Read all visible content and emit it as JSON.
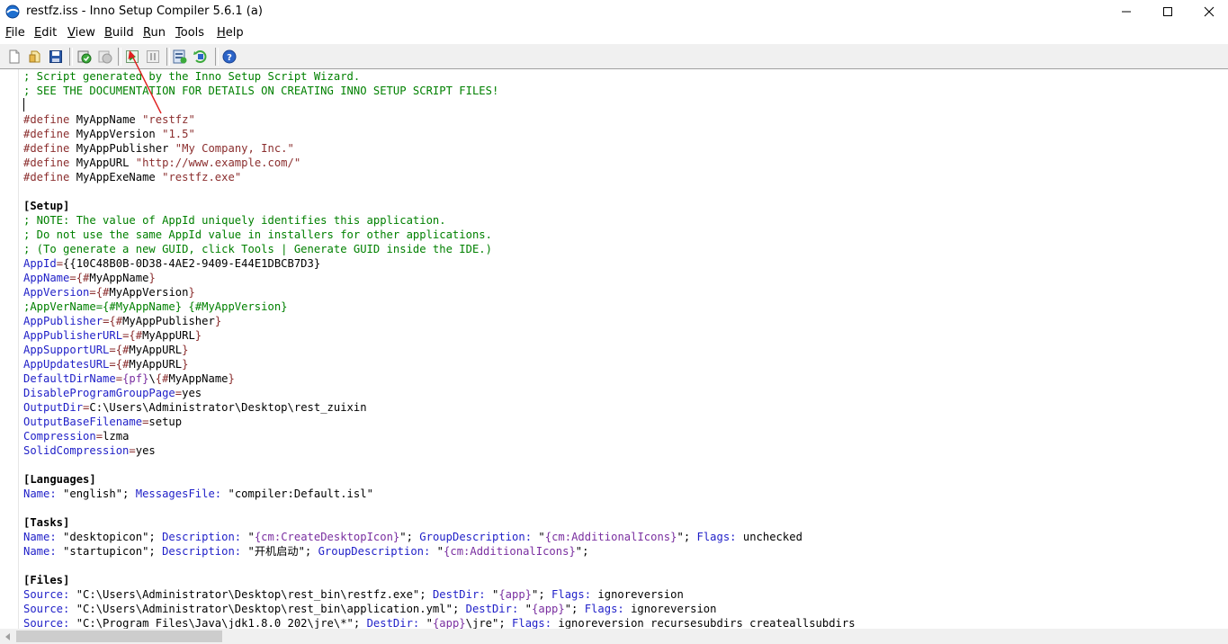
{
  "window": {
    "title": "restfz.iss - Inno Setup Compiler 5.6.1 (a)",
    "controls": {
      "minimize": "—",
      "maximize": "☐",
      "close": "✕"
    }
  },
  "menu": {
    "items": [
      {
        "mnemonic": "F",
        "rest": "ile"
      },
      {
        "mnemonic": "E",
        "rest": "dit"
      },
      {
        "mnemonic": "V",
        "rest": "iew"
      },
      {
        "mnemonic": "B",
        "rest": "uild"
      },
      {
        "mnemonic": "R",
        "rest": "un"
      },
      {
        "mnemonic": "T",
        "rest": "ools"
      },
      {
        "mnemonic": "H",
        "rest": "elp"
      }
    ]
  },
  "toolbar": {
    "buttons": [
      "new-file-icon",
      "open-folder-icon",
      "save-icon",
      "compile-icon",
      "stop-compile-icon",
      "run-icon",
      "pause-icon",
      "target-setup-icon",
      "uninstall-icon",
      "help-icon"
    ],
    "colors": {
      "run": "#2aa02a",
      "help": "#2c64c8"
    }
  },
  "editor": {
    "lines": [
      [
        [
          "cm",
          "; Script generated by the Inno Setup Script Wizard."
        ]
      ],
      [
        [
          "cm",
          "; SEE THE DOCUMENTATION FOR DETAILS ON CREATING INNO SETUP SCRIPT FILES!"
        ]
      ],
      [
        [
          "caret",
          ""
        ]
      ],
      [
        [
          "pp",
          "#define"
        ],
        [
          "pl",
          " MyAppName "
        ],
        [
          "st",
          "\"restfz\""
        ]
      ],
      [
        [
          "pp",
          "#define"
        ],
        [
          "pl",
          " MyAppVersion "
        ],
        [
          "st",
          "\"1.5\""
        ]
      ],
      [
        [
          "pp",
          "#define"
        ],
        [
          "pl",
          " MyAppPublisher "
        ],
        [
          "st",
          "\"My Company, Inc.\""
        ]
      ],
      [
        [
          "pp",
          "#define"
        ],
        [
          "pl",
          " MyAppURL "
        ],
        [
          "st",
          "\"http://www.example.com/\""
        ]
      ],
      [
        [
          "pp",
          "#define"
        ],
        [
          "pl",
          " MyAppExeName "
        ],
        [
          "st",
          "\"restfz.exe\""
        ]
      ],
      [],
      [
        [
          "sec",
          "[Setup]"
        ]
      ],
      [
        [
          "cm",
          "; NOTE: The value of AppId uniquely identifies this application."
        ]
      ],
      [
        [
          "cm",
          "; Do not use the same AppId value in installers for other applications."
        ]
      ],
      [
        [
          "cm",
          "; (To generate a new GUID, click Tools | Generate GUID inside the IDE.)"
        ]
      ],
      [
        [
          "kw",
          "AppId"
        ],
        [
          "op",
          "="
        ],
        [
          "pl",
          "{{10C48B0B-0D38-4AE2-9409-E44E1DBCB7D3}"
        ]
      ],
      [
        [
          "kw",
          "AppName"
        ],
        [
          "op",
          "="
        ],
        [
          "brace",
          "{#"
        ],
        [
          "pl",
          "MyAppName"
        ],
        [
          "brace",
          "}"
        ]
      ],
      [
        [
          "kw",
          "AppVersion"
        ],
        [
          "op",
          "="
        ],
        [
          "brace",
          "{#"
        ],
        [
          "pl",
          "MyAppVersion"
        ],
        [
          "brace",
          "}"
        ]
      ],
      [
        [
          "cm",
          ";AppVerName={#MyAppName} {#MyAppVersion}"
        ]
      ],
      [
        [
          "kw",
          "AppPublisher"
        ],
        [
          "op",
          "="
        ],
        [
          "brace",
          "{#"
        ],
        [
          "pl",
          "MyAppPublisher"
        ],
        [
          "brace",
          "}"
        ]
      ],
      [
        [
          "kw",
          "AppPublisherURL"
        ],
        [
          "op",
          "="
        ],
        [
          "brace",
          "{#"
        ],
        [
          "pl",
          "MyAppURL"
        ],
        [
          "brace",
          "}"
        ]
      ],
      [
        [
          "kw",
          "AppSupportURL"
        ],
        [
          "op",
          "="
        ],
        [
          "brace",
          "{#"
        ],
        [
          "pl",
          "MyAppURL"
        ],
        [
          "brace",
          "}"
        ]
      ],
      [
        [
          "kw",
          "AppUpdatesURL"
        ],
        [
          "op",
          "="
        ],
        [
          "brace",
          "{#"
        ],
        [
          "pl",
          "MyAppURL"
        ],
        [
          "brace",
          "}"
        ]
      ],
      [
        [
          "kw",
          "DefaultDirName"
        ],
        [
          "op",
          "="
        ],
        [
          "cons",
          "{pf}"
        ],
        [
          "pl",
          "\\"
        ],
        [
          "brace",
          "{#"
        ],
        [
          "pl",
          "MyAppName"
        ],
        [
          "brace",
          "}"
        ]
      ],
      [
        [
          "kw",
          "DisableProgramGroupPage"
        ],
        [
          "op",
          "="
        ],
        [
          "pl",
          "yes"
        ]
      ],
      [
        [
          "kw",
          "OutputDir"
        ],
        [
          "op",
          "="
        ],
        [
          "pl",
          "C:\\Users\\Administrator\\Desktop\\rest_zuixin"
        ]
      ],
      [
        [
          "kw",
          "OutputBaseFilename"
        ],
        [
          "op",
          "="
        ],
        [
          "pl",
          "setup"
        ]
      ],
      [
        [
          "kw",
          "Compression"
        ],
        [
          "op",
          "="
        ],
        [
          "pl",
          "lzma"
        ]
      ],
      [
        [
          "kw",
          "SolidCompression"
        ],
        [
          "op",
          "="
        ],
        [
          "pl",
          "yes"
        ]
      ],
      [],
      [
        [
          "sec",
          "[Languages]"
        ]
      ],
      [
        [
          "kw",
          "Name:"
        ],
        [
          "pl",
          " \"english\"; "
        ],
        [
          "kw",
          "MessagesFile:"
        ],
        [
          "pl",
          " \"compiler:Default.isl\""
        ]
      ],
      [],
      [
        [
          "sec",
          "[Tasks]"
        ]
      ],
      [
        [
          "kw",
          "Name:"
        ],
        [
          "pl",
          " \"desktopicon\"; "
        ],
        [
          "kw",
          "Description:"
        ],
        [
          "pl",
          " \""
        ],
        [
          "cons",
          "{cm:CreateDesktopIcon}"
        ],
        [
          "pl",
          "\"; "
        ],
        [
          "kw",
          "GroupDescription:"
        ],
        [
          "pl",
          " \""
        ],
        [
          "cons",
          "{cm:AdditionalIcons}"
        ],
        [
          "pl",
          "\"; "
        ],
        [
          "kw",
          "Flags:"
        ],
        [
          "pl",
          " unchecked"
        ]
      ],
      [
        [
          "kw",
          "Name:"
        ],
        [
          "pl",
          " \"startupicon\"; "
        ],
        [
          "kw",
          "Description:"
        ],
        [
          "pl",
          " \"开机启动\"; "
        ],
        [
          "kw",
          "GroupDescription:"
        ],
        [
          "pl",
          " \""
        ],
        [
          "cons",
          "{cm:AdditionalIcons}"
        ],
        [
          "pl",
          "\";"
        ]
      ],
      [],
      [
        [
          "sec",
          "[Files]"
        ]
      ],
      [
        [
          "kw",
          "Source:"
        ],
        [
          "pl",
          " \"C:\\Users\\Administrator\\Desktop\\rest_bin\\restfz.exe\"; "
        ],
        [
          "kw",
          "DestDir:"
        ],
        [
          "pl",
          " \""
        ],
        [
          "cons",
          "{app}"
        ],
        [
          "pl",
          "\"; "
        ],
        [
          "kw",
          "Flags:"
        ],
        [
          "pl",
          " ignoreversion"
        ]
      ],
      [
        [
          "kw",
          "Source:"
        ],
        [
          "pl",
          " \"C:\\Users\\Administrator\\Desktop\\rest_bin\\application.yml\"; "
        ],
        [
          "kw",
          "DestDir:"
        ],
        [
          "pl",
          " \""
        ],
        [
          "cons",
          "{app}"
        ],
        [
          "pl",
          "\"; "
        ],
        [
          "kw",
          "Flags:"
        ],
        [
          "pl",
          " ignoreversion"
        ]
      ],
      [
        [
          "kw",
          "Source:"
        ],
        [
          "pl",
          " \"C:\\Program Files\\Java\\jdk1.8.0_202\\jre\\*\"; "
        ],
        [
          "kw",
          "DestDir:"
        ],
        [
          "pl",
          " \""
        ],
        [
          "cons",
          "{app}"
        ],
        [
          "pl",
          "\\jre\"; "
        ],
        [
          "kw",
          "Flags:"
        ],
        [
          "pl",
          " ignoreversion recursesubdirs createallsubdirs"
        ]
      ]
    ]
  }
}
